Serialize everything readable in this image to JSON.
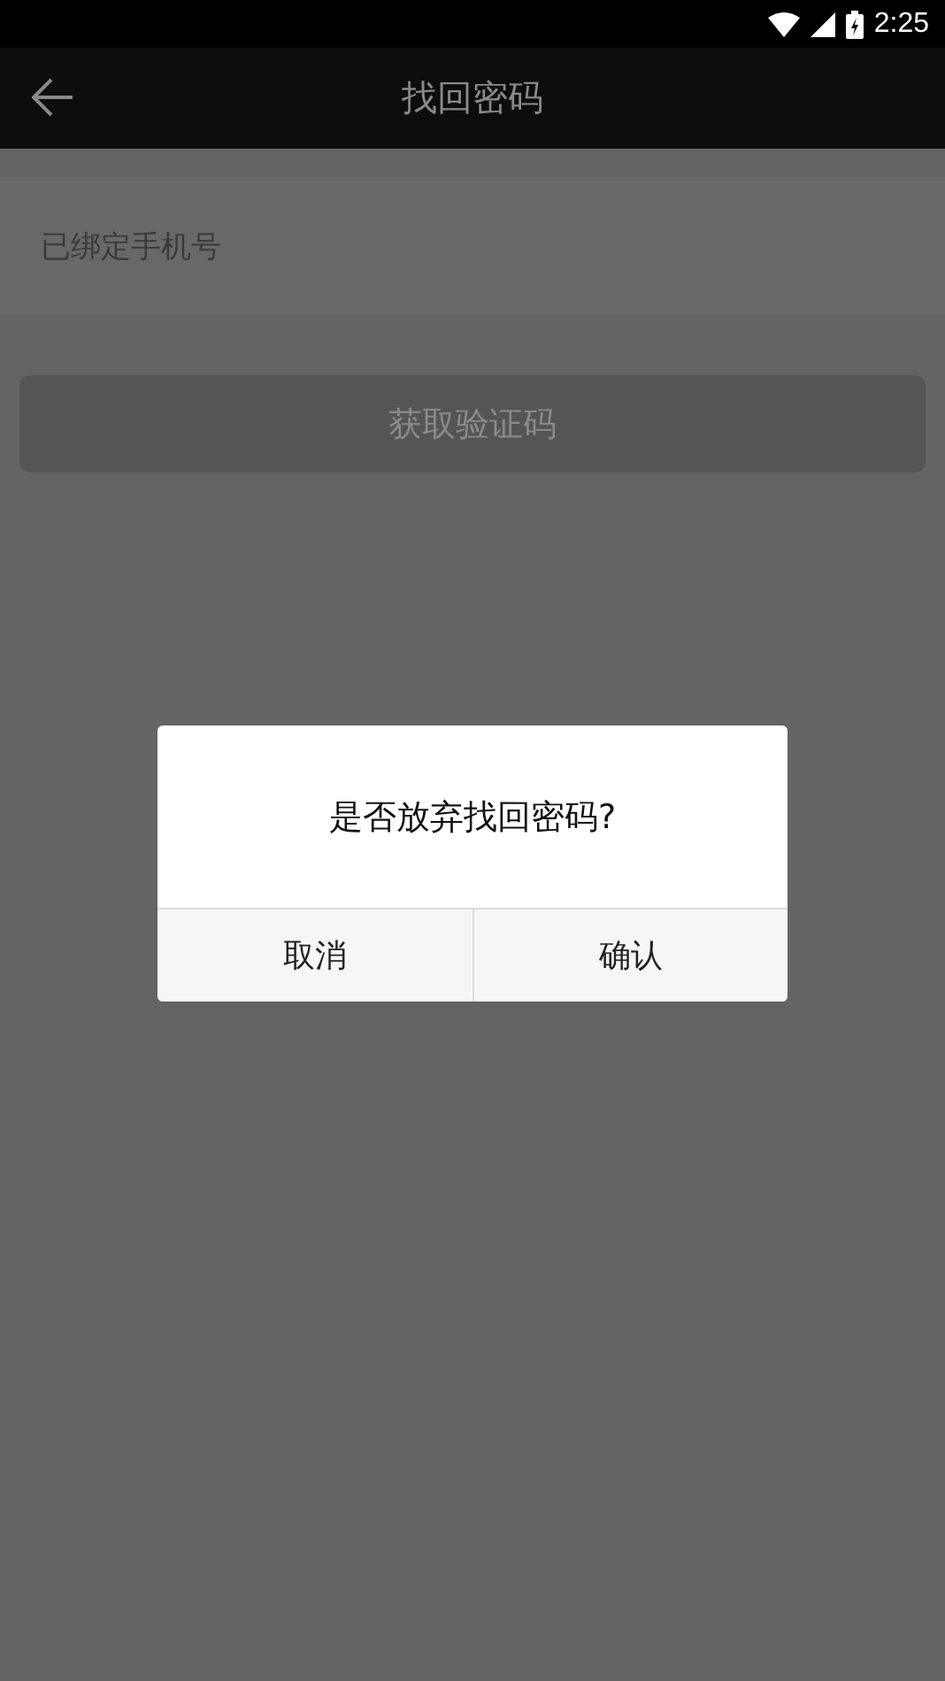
{
  "status_bar": {
    "time": "2:25"
  },
  "toolbar": {
    "title": "找回密码"
  },
  "phone_row": {
    "label": "已绑定手机号"
  },
  "get_code_button": {
    "label": "获取验证码",
    "disabled": true
  },
  "dialog": {
    "message": "是否放弃找回密码?",
    "buttons": [
      "取消",
      "确认"
    ]
  }
}
